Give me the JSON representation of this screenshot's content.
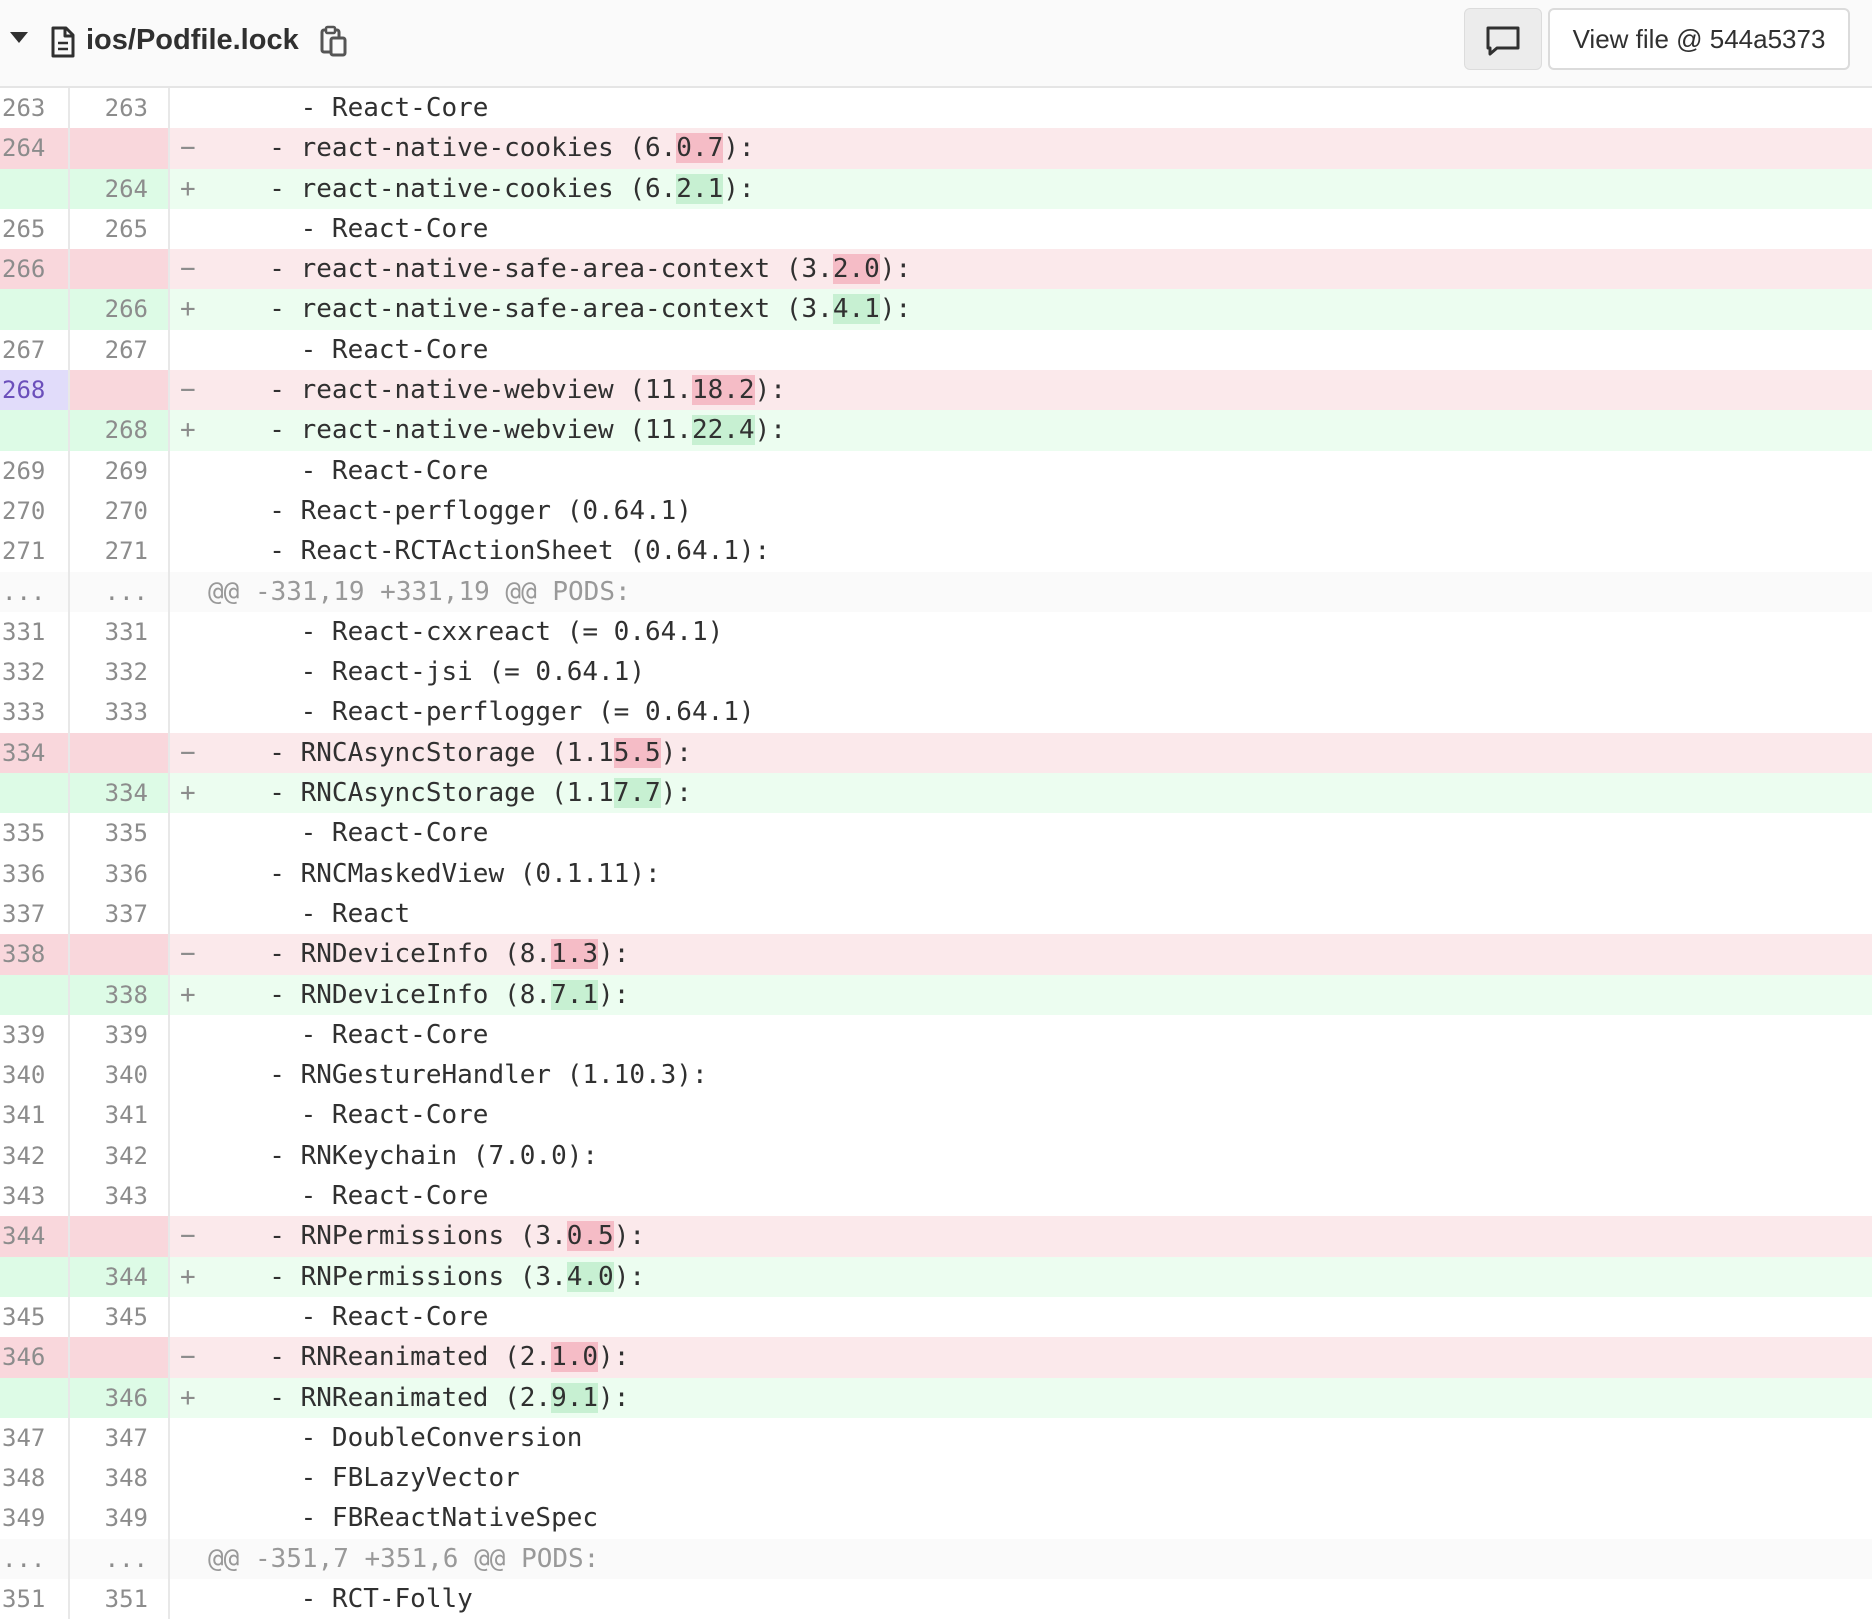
{
  "file": {
    "path": "ios/Podfile.lock",
    "view_file_label": "View file @ 544a5373"
  },
  "diff_rows": [
    {
      "type": "ctx",
      "old": "263",
      "new": "263",
      "mark": "",
      "pre": "    - React-Core",
      "hl": "",
      "post": ""
    },
    {
      "type": "del",
      "old": "264",
      "new": "",
      "mark": "−",
      "pre": "  - react-native-cookies (6.",
      "hl": "0.7",
      "post": "):"
    },
    {
      "type": "add",
      "old": "",
      "new": "264",
      "mark": "+",
      "pre": "  - react-native-cookies (6.",
      "hl": "2.1",
      "post": "):"
    },
    {
      "type": "ctx",
      "old": "265",
      "new": "265",
      "mark": "",
      "pre": "    - React-Core",
      "hl": "",
      "post": ""
    },
    {
      "type": "del",
      "old": "266",
      "new": "",
      "mark": "−",
      "pre": "  - react-native-safe-area-context (3.",
      "hl": "2.0",
      "post": "):"
    },
    {
      "type": "add",
      "old": "",
      "new": "266",
      "mark": "+",
      "pre": "  - react-native-safe-area-context (3.",
      "hl": "4.1",
      "post": "):"
    },
    {
      "type": "ctx",
      "old": "267",
      "new": "267",
      "mark": "",
      "pre": "    - React-Core",
      "hl": "",
      "post": ""
    },
    {
      "type": "del",
      "old": "268",
      "new": "",
      "mark": "−",
      "pre": "  - react-native-webview (11.",
      "hl": "18.2",
      "post": "):",
      "selected": true
    },
    {
      "type": "add",
      "old": "",
      "new": "268",
      "mark": "+",
      "pre": "  - react-native-webview (11.",
      "hl": "22.4",
      "post": "):"
    },
    {
      "type": "ctx",
      "old": "269",
      "new": "269",
      "mark": "",
      "pre": "    - React-Core",
      "hl": "",
      "post": ""
    },
    {
      "type": "ctx",
      "old": "270",
      "new": "270",
      "mark": "",
      "pre": "  - React-perflogger (0.64.1)",
      "hl": "",
      "post": ""
    },
    {
      "type": "ctx",
      "old": "271",
      "new": "271",
      "mark": "",
      "pre": "  - React-RCTActionSheet (0.64.1):",
      "hl": "",
      "post": ""
    },
    {
      "type": "hunk",
      "old": "...",
      "new": "...",
      "mark": "",
      "pre": "@@ -331,19 +331,19 @@ PODS:",
      "hl": "",
      "post": ""
    },
    {
      "type": "ctx",
      "old": "331",
      "new": "331",
      "mark": "",
      "pre": "    - React-cxxreact (= 0.64.1)",
      "hl": "",
      "post": ""
    },
    {
      "type": "ctx",
      "old": "332",
      "new": "332",
      "mark": "",
      "pre": "    - React-jsi (= 0.64.1)",
      "hl": "",
      "post": ""
    },
    {
      "type": "ctx",
      "old": "333",
      "new": "333",
      "mark": "",
      "pre": "    - React-perflogger (= 0.64.1)",
      "hl": "",
      "post": ""
    },
    {
      "type": "del",
      "old": "334",
      "new": "",
      "mark": "−",
      "pre": "  - RNCAsyncStorage (1.1",
      "hl": "5.5",
      "post": "):"
    },
    {
      "type": "add",
      "old": "",
      "new": "334",
      "mark": "+",
      "pre": "  - RNCAsyncStorage (1.1",
      "hl": "7.7",
      "post": "):"
    },
    {
      "type": "ctx",
      "old": "335",
      "new": "335",
      "mark": "",
      "pre": "    - React-Core",
      "hl": "",
      "post": ""
    },
    {
      "type": "ctx",
      "old": "336",
      "new": "336",
      "mark": "",
      "pre": "  - RNCMaskedView (0.1.11):",
      "hl": "",
      "post": ""
    },
    {
      "type": "ctx",
      "old": "337",
      "new": "337",
      "mark": "",
      "pre": "    - React",
      "hl": "",
      "post": ""
    },
    {
      "type": "del",
      "old": "338",
      "new": "",
      "mark": "−",
      "pre": "  - RNDeviceInfo (8.",
      "hl": "1.3",
      "post": "):"
    },
    {
      "type": "add",
      "old": "",
      "new": "338",
      "mark": "+",
      "pre": "  - RNDeviceInfo (8.",
      "hl": "7.1",
      "post": "):"
    },
    {
      "type": "ctx",
      "old": "339",
      "new": "339",
      "mark": "",
      "pre": "    - React-Core",
      "hl": "",
      "post": ""
    },
    {
      "type": "ctx",
      "old": "340",
      "new": "340",
      "mark": "",
      "pre": "  - RNGestureHandler (1.10.3):",
      "hl": "",
      "post": ""
    },
    {
      "type": "ctx",
      "old": "341",
      "new": "341",
      "mark": "",
      "pre": "    - React-Core",
      "hl": "",
      "post": ""
    },
    {
      "type": "ctx",
      "old": "342",
      "new": "342",
      "mark": "",
      "pre": "  - RNKeychain (7.0.0):",
      "hl": "",
      "post": ""
    },
    {
      "type": "ctx",
      "old": "343",
      "new": "343",
      "mark": "",
      "pre": "    - React-Core",
      "hl": "",
      "post": ""
    },
    {
      "type": "del",
      "old": "344",
      "new": "",
      "mark": "−",
      "pre": "  - RNPermissions (3.",
      "hl": "0.5",
      "post": "):"
    },
    {
      "type": "add",
      "old": "",
      "new": "344",
      "mark": "+",
      "pre": "  - RNPermissions (3.",
      "hl": "4.0",
      "post": "):"
    },
    {
      "type": "ctx",
      "old": "345",
      "new": "345",
      "mark": "",
      "pre": "    - React-Core",
      "hl": "",
      "post": ""
    },
    {
      "type": "del",
      "old": "346",
      "new": "",
      "mark": "−",
      "pre": "  - RNReanimated (2.",
      "hl": "1.0",
      "post": "):"
    },
    {
      "type": "add",
      "old": "",
      "new": "346",
      "mark": "+",
      "pre": "  - RNReanimated (2.",
      "hl": "9.1",
      "post": "):"
    },
    {
      "type": "ctx",
      "old": "347",
      "new": "347",
      "mark": "",
      "pre": "    - DoubleConversion",
      "hl": "",
      "post": ""
    },
    {
      "type": "ctx",
      "old": "348",
      "new": "348",
      "mark": "",
      "pre": "    - FBLazyVector",
      "hl": "",
      "post": ""
    },
    {
      "type": "ctx",
      "old": "349",
      "new": "349",
      "mark": "",
      "pre": "    - FBReactNativeSpec",
      "hl": "",
      "post": ""
    },
    {
      "type": "hunk",
      "old": "...",
      "new": "...",
      "mark": "",
      "pre": "@@ -351,7 +351,6 @@ PODS:",
      "hl": "",
      "post": ""
    },
    {
      "type": "ctx",
      "old": "351",
      "new": "351",
      "mark": "",
      "pre": "    - RCT-Folly",
      "hl": "",
      "post": ""
    }
  ],
  "colors": {
    "deleted_bg": "#fbe9eb",
    "added_bg": "#ecfdf0",
    "deleted_highlight": "#f5bcc6",
    "added_highlight": "#c7f0d2",
    "selected_line": "#6b4fbb"
  },
  "icons": {
    "collapse": "chevron-down-icon",
    "file": "file-icon",
    "copy": "copy-clipboard-icon",
    "comment": "comment-icon"
  }
}
